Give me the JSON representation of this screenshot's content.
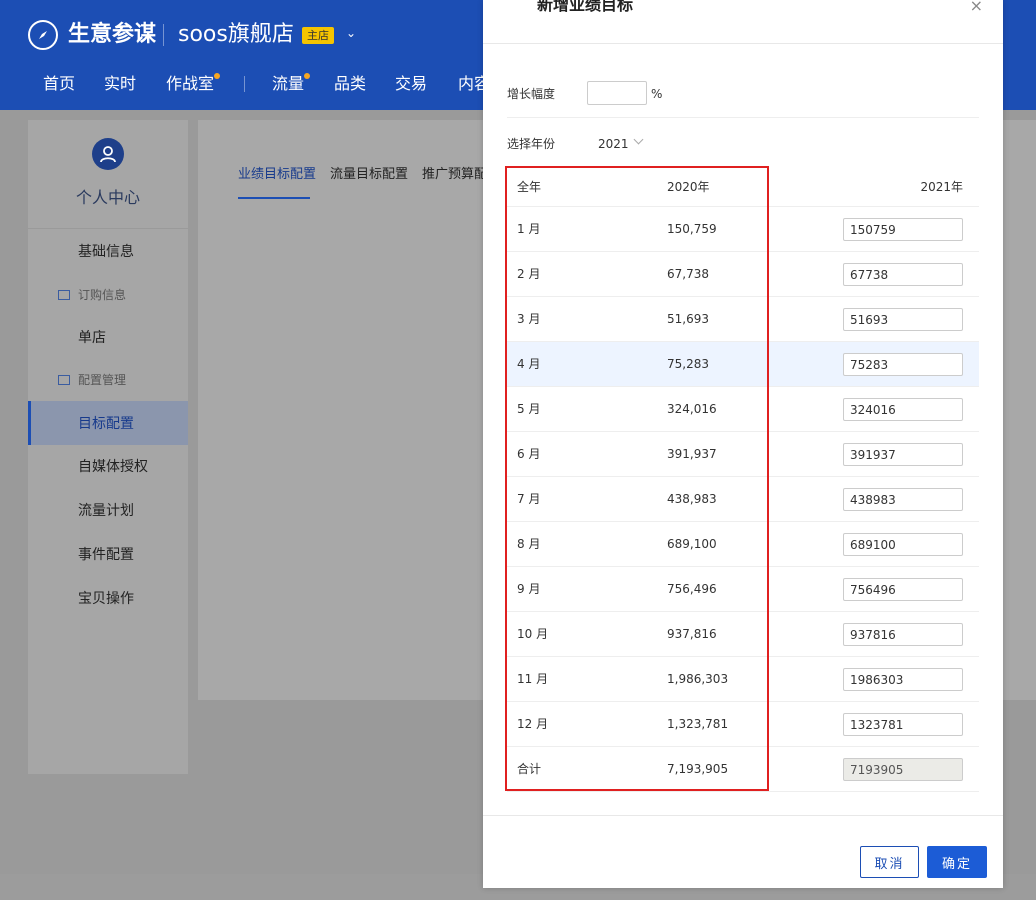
{
  "header": {
    "brand": "生意参谋",
    "store_name": "soos旗舰店",
    "store_badge": "主店",
    "nav": [
      "首页",
      "实时",
      "作战室",
      "流量",
      "品类",
      "交易",
      "内容"
    ]
  },
  "sidebar": {
    "title": "个人中心",
    "items": [
      "基础信息",
      "订购信息",
      "单店",
      "配置管理",
      "目标配置",
      "自媒体授权",
      "流量计划",
      "事件配置",
      "宝贝操作"
    ]
  },
  "tabs": [
    "业绩目标配置",
    "流量目标配置",
    "推广预算配"
  ],
  "modal": {
    "title": "新增业绩目标",
    "close": "×",
    "growth_label": "增长幅度",
    "growth_value": "",
    "growth_unit": "%",
    "year_label": "选择年份",
    "year_value": "2021",
    "table": {
      "headers": [
        "全年",
        "2020年",
        "2021年"
      ],
      "rows": [
        {
          "month": "1 月",
          "v2020": "150,759",
          "v2021": "150759"
        },
        {
          "month": "2 月",
          "v2020": "67,738",
          "v2021": "67738"
        },
        {
          "month": "3 月",
          "v2020": "51,693",
          "v2021": "51693"
        },
        {
          "month": "4 月",
          "v2020": "75,283",
          "v2021": "75283"
        },
        {
          "month": "5 月",
          "v2020": "324,016",
          "v2021": "324016"
        },
        {
          "month": "6 月",
          "v2020": "391,937",
          "v2021": "391937"
        },
        {
          "month": "7 月",
          "v2020": "438,983",
          "v2021": "438983"
        },
        {
          "month": "8 月",
          "v2020": "689,100",
          "v2021": "689100"
        },
        {
          "month": "9 月",
          "v2020": "756,496",
          "v2021": "756496"
        },
        {
          "month": "10 月",
          "v2020": "937,816",
          "v2021": "937816"
        },
        {
          "month": "11 月",
          "v2020": "1,986,303",
          "v2021": "1986303"
        },
        {
          "month": "12 月",
          "v2020": "1,323,781",
          "v2021": "1323781"
        }
      ],
      "total": {
        "month": "合计",
        "v2020": "7,193,905",
        "v2021": "7193905"
      }
    },
    "cancel_label": "取消",
    "ok_label": "确定"
  },
  "colors": {
    "header": "#1c4eb4",
    "primary": "#1c5cd6",
    "highlight": "#e02020"
  }
}
